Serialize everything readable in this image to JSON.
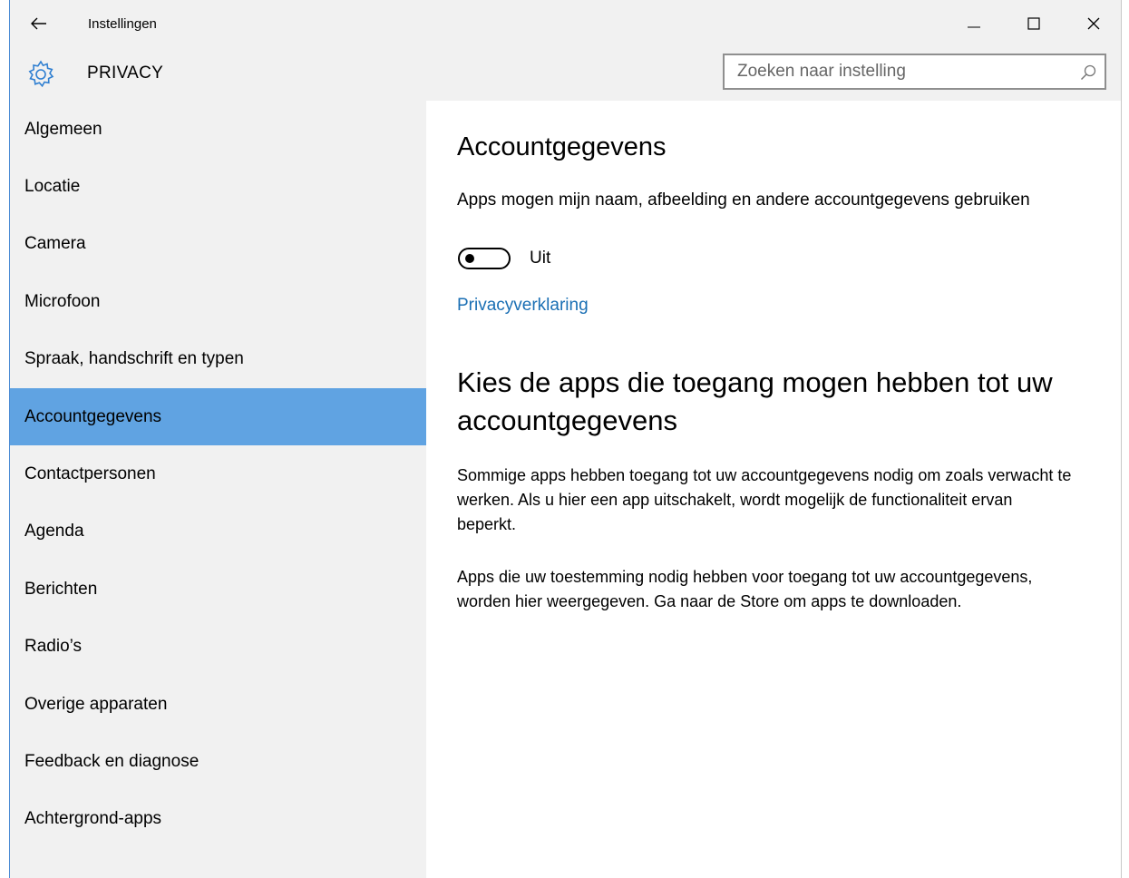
{
  "window": {
    "title": "Instellingen"
  },
  "header": {
    "section_title": "PRIVACY",
    "search_placeholder": "Zoeken naar instelling"
  },
  "sidebar": {
    "items": [
      {
        "label": "Algemeen",
        "selected": false
      },
      {
        "label": "Locatie",
        "selected": false
      },
      {
        "label": "Camera",
        "selected": false
      },
      {
        "label": "Microfoon",
        "selected": false
      },
      {
        "label": "Spraak, handschrift en typen",
        "selected": false
      },
      {
        "label": "Accountgegevens",
        "selected": true
      },
      {
        "label": "Contactpersonen",
        "selected": false
      },
      {
        "label": "Agenda",
        "selected": false
      },
      {
        "label": "Berichten",
        "selected": false
      },
      {
        "label": "Radio’s",
        "selected": false
      },
      {
        "label": "Overige apparaten",
        "selected": false
      },
      {
        "label": "Feedback en diagnose",
        "selected": false
      },
      {
        "label": "Achtergrond-apps",
        "selected": false
      }
    ]
  },
  "content": {
    "heading": "Accountgegevens",
    "toggle_label": "Apps mogen mijn naam, afbeelding en andere accountgegevens gebruiken",
    "toggle_state": "Uit",
    "privacy_link": "Privacyverklaring",
    "subheading": "Kies de apps die toegang mogen hebben tot uw accountgegevens",
    "paragraph1": "Sommige apps hebben toegang tot uw accountgegevens nodig om zoals verwacht te werken. Als u hier een app uitschakelt, wordt mogelijk de functionaliteit ervan beperkt.",
    "paragraph2": "Apps die uw toestemming nodig hebben voor toegang tot uw accountgegevens, worden hier weergegeven. Ga naar de Store om apps te downloaden."
  },
  "colors": {
    "accent": "#60a3e2",
    "link": "#1a6fb4",
    "chrome": "#f1f1f1"
  },
  "icons": {
    "back": "back-arrow-icon",
    "settings": "gear-icon",
    "search": "search-icon",
    "minimize": "minimize-icon",
    "maximize": "maximize-icon",
    "close": "close-icon"
  }
}
